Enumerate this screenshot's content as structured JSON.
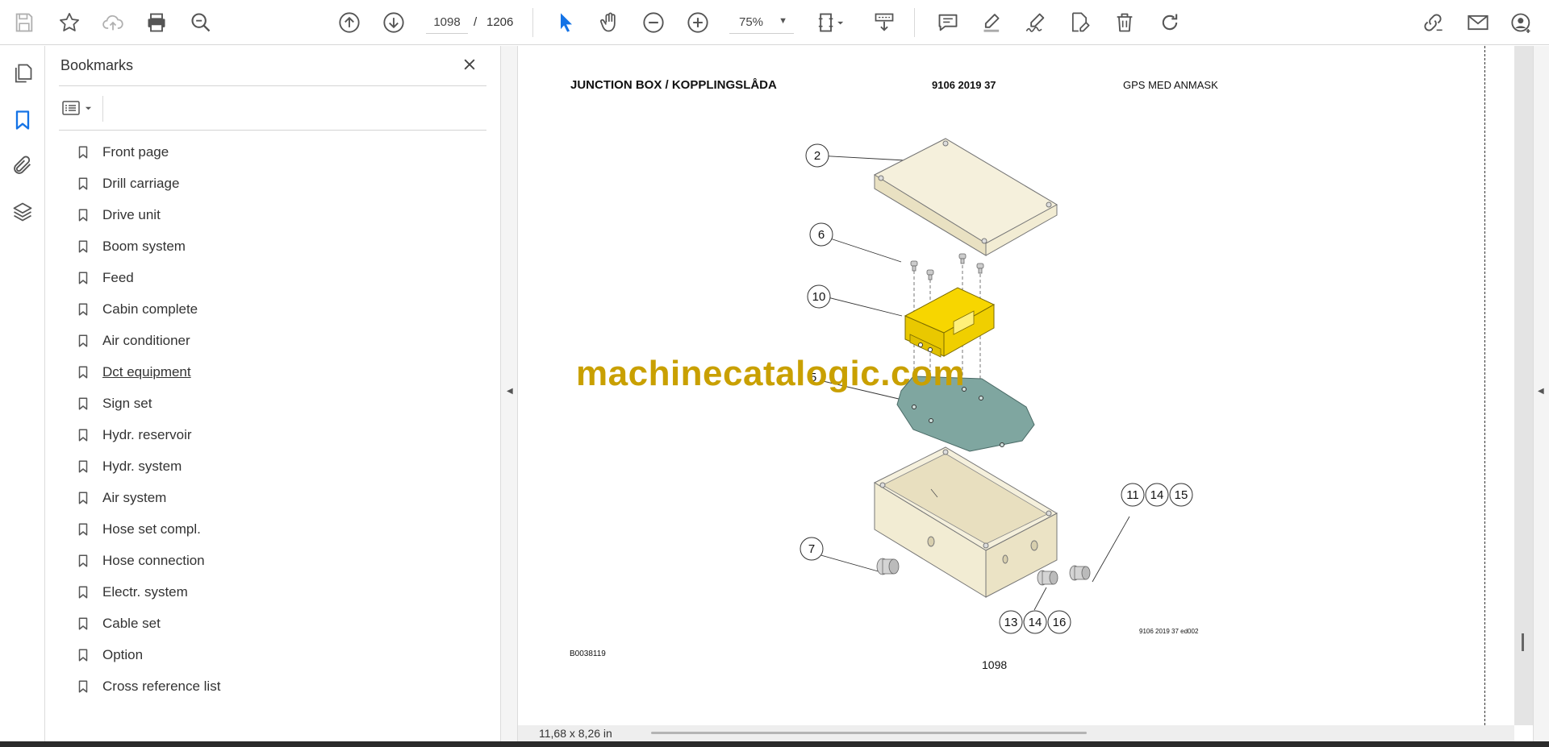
{
  "toolbar": {
    "page_current": "1098",
    "page_separator": "/",
    "page_total": "1206",
    "zoom": "75%",
    "icons": [
      "save-icon",
      "star-icon",
      "cloud-upload-icon",
      "print-icon",
      "zoom-search-icon",
      "page-up-icon",
      "page-down-icon",
      "select-cursor-icon",
      "hand-icon",
      "zoom-out-icon",
      "zoom-in-icon",
      "fit-page-icon",
      "scroll-mode-icon",
      "comment-icon",
      "highlight-icon",
      "sign-icon",
      "edit-pdf-icon",
      "delete-icon",
      "redo-icon",
      "share-link-icon",
      "email-icon",
      "account-icon"
    ]
  },
  "bookmarks": {
    "title": "Bookmarks",
    "items": [
      {
        "label": "Front page"
      },
      {
        "label": "Drill carriage"
      },
      {
        "label": "Drive unit"
      },
      {
        "label": "Boom system"
      },
      {
        "label": "Feed"
      },
      {
        "label": "Cabin complete"
      },
      {
        "label": "Air conditioner"
      },
      {
        "label": "Dct equipment "
      },
      {
        "label": "Sign set"
      },
      {
        "label": "Hydr. reservoir"
      },
      {
        "label": "Hydr. system"
      },
      {
        "label": "Air system"
      },
      {
        "label": "Hose set compl."
      },
      {
        "label": "Hose connection"
      },
      {
        "label": "Electr. system"
      },
      {
        "label": "Cable set"
      },
      {
        "label": "Option"
      },
      {
        "label": "Cross reference list"
      }
    ]
  },
  "document": {
    "title": "JUNCTION BOX / KOPPLINGSLÅDA",
    "part_number": "9106 2019 37",
    "description": "GPS MED ANMASK",
    "watermark": "machinecatalogic.com",
    "figure_code": "B0038119",
    "figure_ref": "9106 2019 37 ed002",
    "page_number": "1098",
    "callouts": {
      "c2": "2",
      "c6": "6",
      "c10": "10",
      "c5": "5",
      "c7": "7",
      "c11": "11",
      "c14a": "14",
      "c15": "15",
      "c13": "13",
      "c14b": "14",
      "c16": "16"
    }
  },
  "status": {
    "page_size": "11,68 x 8,26 in"
  },
  "colors": {
    "accent_blue": "#1473e6",
    "watermark": "#c9a000",
    "part_beige": "#f2ecd3",
    "part_yellow": "#f7d600",
    "part_teal": "#7fa6a0"
  }
}
